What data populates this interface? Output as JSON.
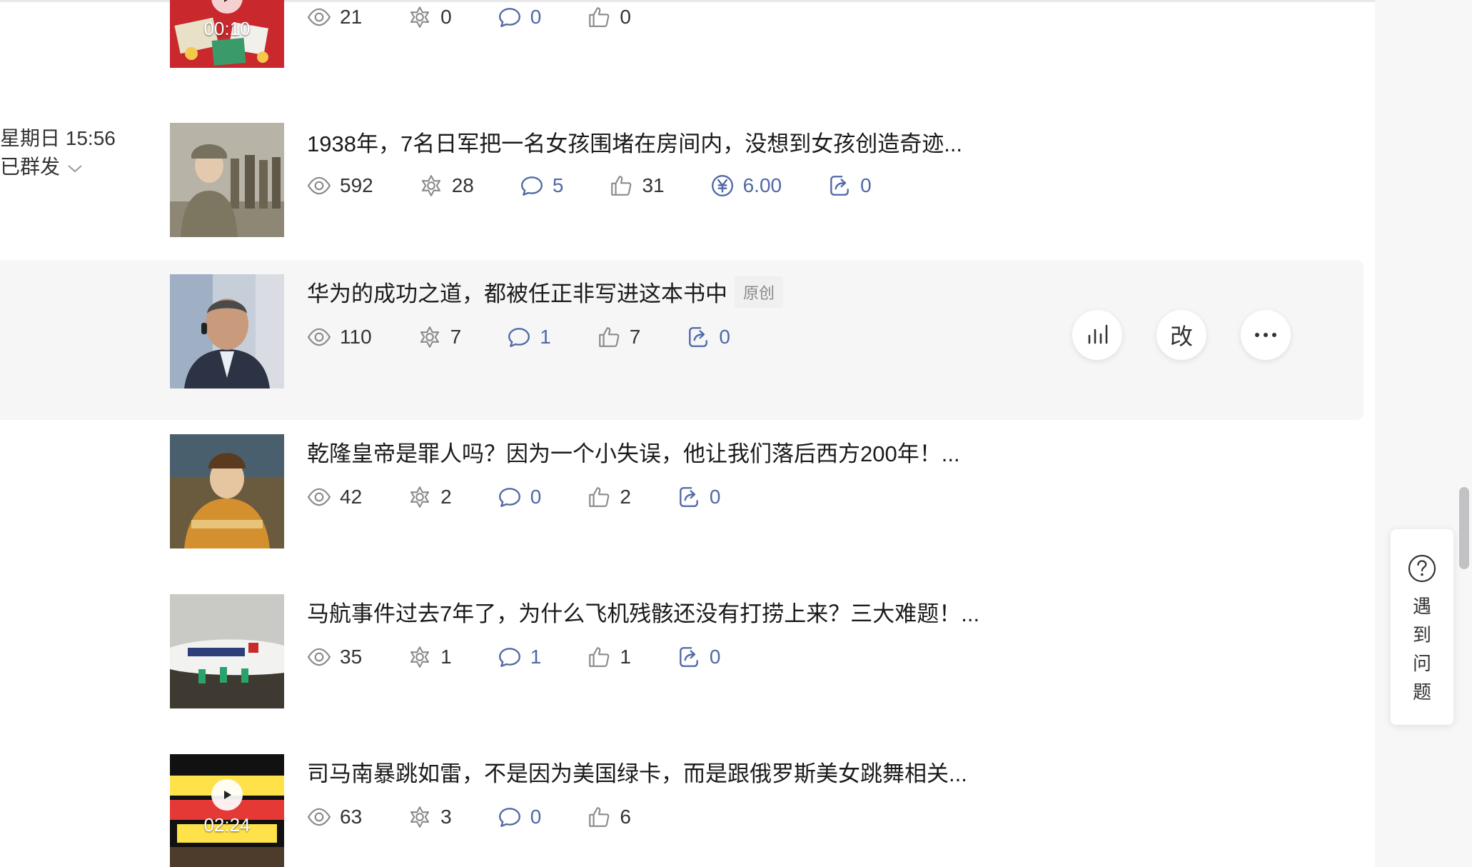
{
  "articles": [
    {
      "title": "",
      "duration": "00:10",
      "stats": {
        "views": "21",
        "recommends": "0",
        "comments": "0",
        "likes": "0"
      }
    },
    {
      "date": "星期日 15:56",
      "status": "已群发",
      "title": "1938年，7名日军把一名女孩围堵在房间内，没想到女孩创造奇迹...",
      "stats": {
        "views": "592",
        "recommends": "28",
        "comments": "5",
        "likes": "31",
        "reward": "6.00",
        "shares": "0"
      }
    },
    {
      "title": "华为的成功之道，都被任正非写进这本书中",
      "tag": "原创",
      "stats": {
        "views": "110",
        "recommends": "7",
        "comments": "1",
        "likes": "7",
        "shares": "0"
      },
      "actions": {
        "edit_label": "改"
      }
    },
    {
      "title": "乾隆皇帝是罪人吗？因为一个小失误，他让我们落后西方200年！...",
      "stats": {
        "views": "42",
        "recommends": "2",
        "comments": "0",
        "likes": "2",
        "shares": "0"
      }
    },
    {
      "title": "马航事件过去7年了，为什么飞机残骸还没有打捞上来？三大难题！...",
      "stats": {
        "views": "35",
        "recommends": "1",
        "comments": "1",
        "likes": "1",
        "shares": "0"
      }
    },
    {
      "title": "司马南暴跳如雷，不是因为美国绿卡，而是跟俄罗斯美女跳舞相关...",
      "duration": "02:24",
      "stats": {
        "views": "63",
        "recommends": "3",
        "comments": "0",
        "likes": "6"
      }
    }
  ],
  "help": {
    "label": "遇到问题"
  },
  "colors": {
    "blue": "#4f68a5",
    "gray_text": "#333333",
    "hover_bg": "#f6f6f7"
  }
}
